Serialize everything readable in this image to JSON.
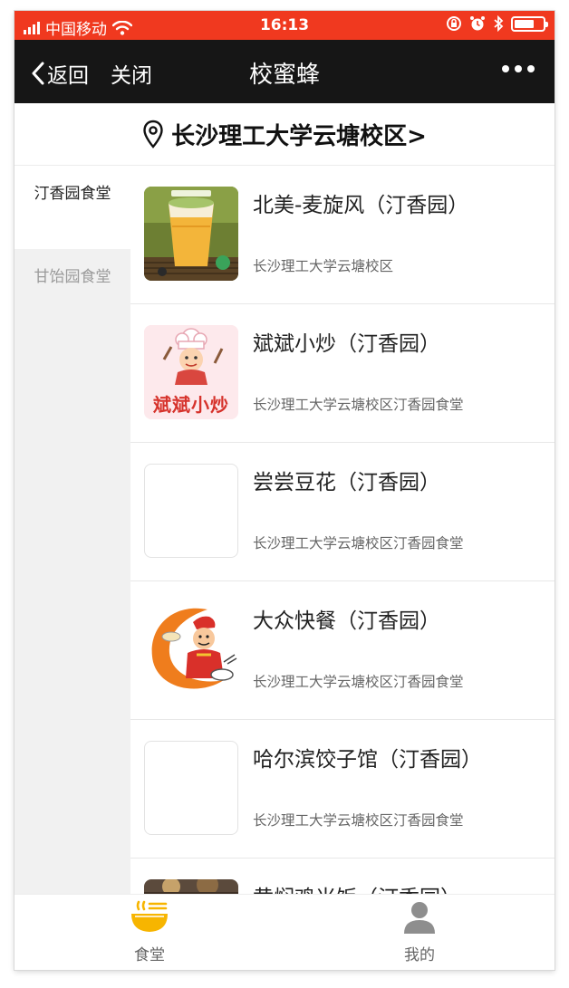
{
  "status_bar": {
    "carrier": "中国移动",
    "time": "16:13",
    "battery_level": 0.7
  },
  "nav": {
    "back_label": "返回",
    "close_label": "关闭",
    "title": "校蜜蜂"
  },
  "location": {
    "label": "长沙理工大学云塘校区>"
  },
  "sidebar": {
    "items": [
      {
        "label": "汀香园食堂",
        "active": true
      },
      {
        "label": "甘饴园食堂",
        "active": false
      }
    ]
  },
  "stores": [
    {
      "name": "北美-麦旋风（汀香园）",
      "address": "长沙理工大学云塘校区",
      "image": "milk-tea-photo"
    },
    {
      "name": "斌斌小炒（汀香园）",
      "address": "长沙理工大学云塘校区汀香园食堂",
      "image": "chef-logo",
      "logo_text": "斌斌小炒"
    },
    {
      "name": "尝尝豆花（汀香园）",
      "address": "长沙理工大学云塘校区汀香园食堂",
      "image": "blank"
    },
    {
      "name": "大众快餐（汀香园）",
      "address": "长沙理工大学云塘校区汀香园食堂",
      "image": "cartoon-chef-logo"
    },
    {
      "name": "哈尔滨饺子馆（汀香园）",
      "address": "长沙理工大学云塘校区汀香园食堂",
      "image": "blank"
    },
    {
      "name": "黄焖鸡米饭（汀香园）",
      "address": "",
      "image": "food-photo"
    }
  ],
  "tabbar": {
    "items": [
      {
        "label": "食堂",
        "icon": "bowl-icon",
        "active": true
      },
      {
        "label": "我的",
        "icon": "person-icon",
        "active": false
      }
    ]
  },
  "colors": {
    "status_bar": "#f0391f",
    "nav_bar": "#161616",
    "accent_yellow": "#f7b500"
  }
}
